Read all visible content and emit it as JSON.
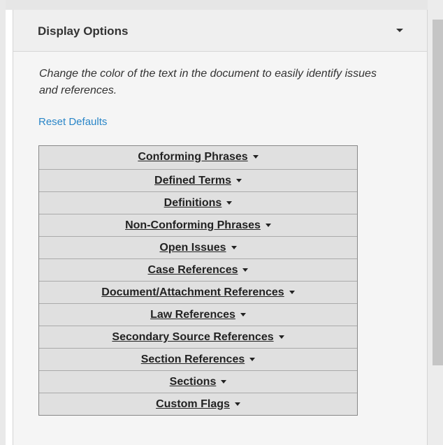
{
  "panel": {
    "title": "Display Options",
    "description": "Change the color of the text in the document to easily identify issues and references.",
    "reset_label": "Reset Defaults"
  },
  "options": [
    {
      "label": "Conforming Phrases",
      "icon": "caret-down-icon"
    },
    {
      "label": "Defined Terms",
      "icon": "caret-down-icon"
    },
    {
      "label": "Definitions",
      "icon": "caret-down-icon"
    },
    {
      "label": "Non-Conforming Phrases",
      "icon": "caret-down-icon"
    },
    {
      "label": "Open Issues",
      "icon": "caret-down-icon"
    },
    {
      "label": "Case References",
      "icon": "caret-down-icon"
    },
    {
      "label": "Document/Attachment References",
      "icon": "caret-down-icon"
    },
    {
      "label": "Law References",
      "icon": "caret-down-icon"
    },
    {
      "label": "Secondary Source References",
      "icon": "caret-down-icon"
    },
    {
      "label": "Section References",
      "icon": "caret-down-icon"
    },
    {
      "label": "Sections",
      "icon": "caret-down-icon"
    },
    {
      "label": "Custom Flags",
      "icon": "caret-down-icon"
    }
  ],
  "colors": {
    "link": "#2a86c8",
    "panel_bg": "#f5f5f5",
    "button_bg": "#e0e0e0"
  }
}
